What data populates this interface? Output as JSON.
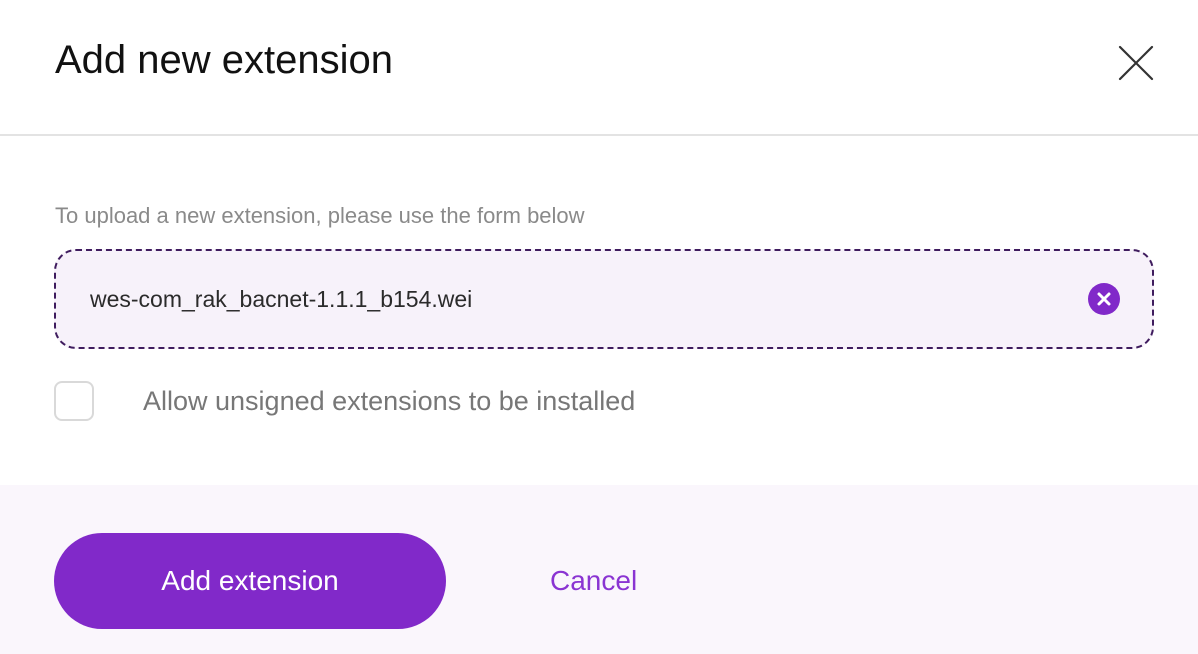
{
  "dialog": {
    "title": "Add new extension",
    "close_icon": "close-icon"
  },
  "upload": {
    "hint": "To upload a new extension, please use the form below",
    "filename": "wes-com_rak_bacnet-1.1.1_b154.wei",
    "clear_icon": "clear-circle-icon"
  },
  "options": {
    "allow_unsigned_label": "Allow unsigned extensions to be installed",
    "allow_unsigned_checked": false
  },
  "actions": {
    "submit_label": "Add extension",
    "cancel_label": "Cancel"
  },
  "colors": {
    "accent": "#8129c9",
    "dropzone_border": "#3f1c5e",
    "dropzone_bg": "#f7f2fa",
    "footer_bg": "#faf6fc"
  }
}
